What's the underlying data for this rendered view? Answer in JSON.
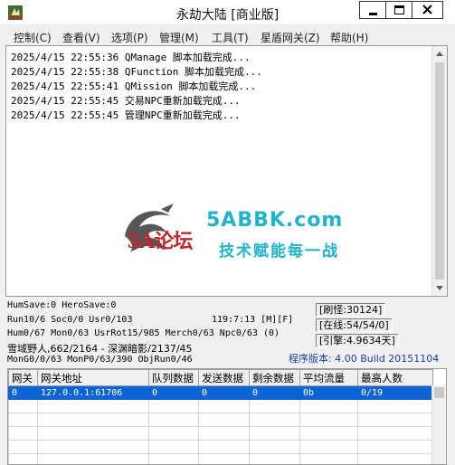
{
  "window": {
    "title": "永劫大陆 [商业版]",
    "icon": "app-icon"
  },
  "menu": [
    {
      "label": "控制(C)"
    },
    {
      "label": "查看(V)"
    },
    {
      "label": "选项(P)"
    },
    {
      "label": "管理(M)"
    },
    {
      "label": "工具(T)"
    },
    {
      "label": "星盾网关(Z)"
    },
    {
      "label": "帮助(H)"
    }
  ],
  "log": [
    "2025/4/15 22:55:36 QManage 脚本加载完成...",
    "2025/4/15 22:55:38 QFunction 脚本加载完成...",
    "2025/4/15 22:55:41 QMission 脚本加载完成...",
    "2025/4/15 22:55:45 交易NPC重新加载完成...",
    "2025/4/15 22:55:45 管理NPC重新加载完成..."
  ],
  "watermark": {
    "logo_text": "5A论坛",
    "site": "5ABBK.com",
    "slogan": "技术赋能每一战"
  },
  "status": {
    "line1": "HumSave:0 HeroSave:0",
    "line2": "Run10/6 Soc0/0 Usr0/103",
    "time": "119:7:13 [M][F]",
    "line3": "Hum0/67 Mon0/63 UsrRot15/985 Merch0/63 Npc0/63 (0)",
    "line4": "雪域野人,662/2164 - 深渊暗影/2137/45",
    "line5": "MonG0/0/63 MonP0/63/390 ObjRun0/46",
    "refresh_monsters": "[刷怪:30124]",
    "online": "[在线:54/54/0]",
    "engine": "[引擎:4.9634天]",
    "version": "程序版本: 4.00 Build 20151104"
  },
  "gateway_table": {
    "columns": [
      "网关",
      "网关地址",
      "队列数据",
      "发送数据",
      "剩余数据",
      "平均流量",
      "最高人数"
    ],
    "rows": [
      [
        "0",
        "127.0.0.1:61706",
        "0",
        "0",
        "0",
        "0b",
        "0/19"
      ],
      [
        "",
        "",
        "",
        "",
        "",
        "",
        ""
      ],
      [
        "",
        "",
        "",
        "",
        "",
        "",
        ""
      ],
      [
        "",
        "",
        "",
        "",
        "",
        "",
        ""
      ],
      [
        "",
        "",
        "",
        "",
        "",
        "",
        ""
      ],
      [
        "",
        "",
        "",
        "",
        "",
        "",
        ""
      ]
    ]
  },
  "colors": {
    "selection": "#0a64d6",
    "version_text": "#1a3fa8",
    "watermark_teal": "#21b3c9",
    "watermark_red": "#c0282e"
  }
}
